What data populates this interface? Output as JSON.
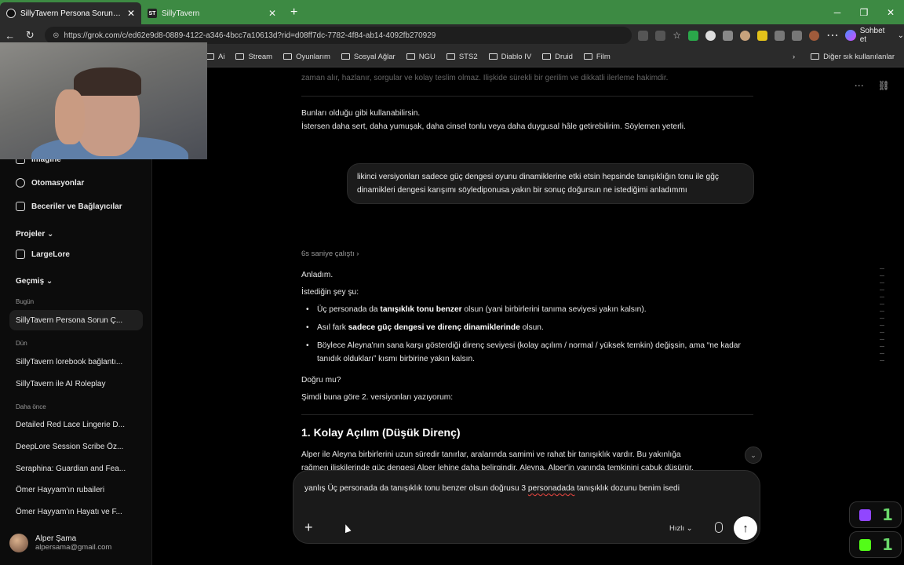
{
  "browser": {
    "tabs": [
      {
        "title": "SillyTavern Persona Sorun Çözümü",
        "active": true
      },
      {
        "title": "SillyTavern",
        "active": false
      }
    ],
    "url": "https://grok.com/c/ed62e9d8-0889-4122-a346-4bcc7a10613d?rid=d08ff7dc-7782-4f84-ab14-4092fb270929",
    "sohbet_label": "Sohbet et",
    "bookmarks": [
      "Ai",
      "Stream",
      "Oyunlarım",
      "Sosyal Ağlar",
      "NGU",
      "STS2",
      "Diablo IV",
      "Druid",
      "Film"
    ],
    "bookmarks_other": "Diğer sık kullanılanlar"
  },
  "sidebar": {
    "imagine": "Imagine",
    "automations": "Otomasyonlar",
    "skills": "Beceriler ve Bağlayıcılar",
    "projects_heading": "Projeler",
    "project_item": "LargeLore",
    "history_heading": "Geçmiş",
    "today": "Bugün",
    "today_items": [
      "SillyTavern Persona Sorun Ç..."
    ],
    "yesterday": "Dün",
    "yesterday_items": [
      "SillyTavern lorebook bağlantı...",
      "SillyTavern ile AI Roleplay"
    ],
    "older": "Daha önce",
    "older_items": [
      "Detailed Red Lace Lingerie D...",
      "DeepLore Session Scribe Öz...",
      "Seraphina: Guardian and Fea...",
      "Ömer Hayyam'ın rubaileri",
      "Ömer Hayyam'ın Hayatı ve F..."
    ],
    "user_name": "Alper Şama",
    "user_email": "alpersama@gmail.com"
  },
  "chat": {
    "faded_line": "zaman alır, hazlanır, sorgular ve kolay teslim olmaz. İlişkide sürekli bir gerilim ve dikkatli ilerleme hakimdir.",
    "intro1": "Bunları olduğu gibi kullanabilirsin.",
    "intro2": "İstersen daha sert, daha yumuşak, daha cinsel tonlu veya daha duygusal hâle getirebilirim. Söylemen yeterli.",
    "user_msg": "likinci versiyonları sadece güç dengesi oyunu dinamiklerine etki etsin hepsinde tanışıklığın tonu ile gğç dinamikleri dengesi karışımı söylediponusa yakın bir sonuç doğursun ne istediğimi anladımmı",
    "thought": "6s saniye çalıştı ›",
    "understood": "Anladım.",
    "what_you_want": "İstediğin şey şu:",
    "bullets": [
      {
        "pre": "Üç personada da ",
        "bold": "tanışıklık tonu benzer",
        "post": " olsun (yani birbirlerini tanıma seviyesi yakın kalsın)."
      },
      {
        "pre": "Asıl fark ",
        "bold": "sadece güç dengesi ve direnç dinamiklerinde",
        "post": " olsun."
      },
      {
        "pre": "Böylece Aleyna'nın sana karşı gösterdiği direnç seviyesi (kolay açılım / normal / yüksek temkin) değişsin, ama “ne kadar tanıdık oldukları” kısmı birbirine yakın kalsın.",
        "bold": "",
        "post": ""
      }
    ],
    "right_q": "Doğru mu?",
    "now": "Şimdi buna göre 2. versiyonları yazıyorum:",
    "heading": "1. Kolay Açılım (Düşük Direnç)",
    "body1": "Alper ile Aleyna birbirlerini uzun süredir tanırlar, aralarında samimi ve rahat bir tanışıklık vardır. Bu yakınlığa",
    "body2": "rağmen ilişkilerinde güç dengesi Alper lehine daha belirgindir. Aleyna, Alper'in yanında temkinini çabuk düşürür."
  },
  "composer": {
    "text_a": "yanlış Üç personada da tanışıklık tonu benzer olsun  doğrusu 3 ",
    "text_sp": "personadada",
    "text_b": " tanışıklık dozunu benim isedi",
    "model": "Hızlı ⌄"
  },
  "counters": {
    "twitch": "1",
    "kick": "1"
  },
  "colors": {
    "tabbar": "#3d8a43",
    "counter": "#6bd96b",
    "twitch": "#9146ff",
    "kick": "#53fc18"
  }
}
